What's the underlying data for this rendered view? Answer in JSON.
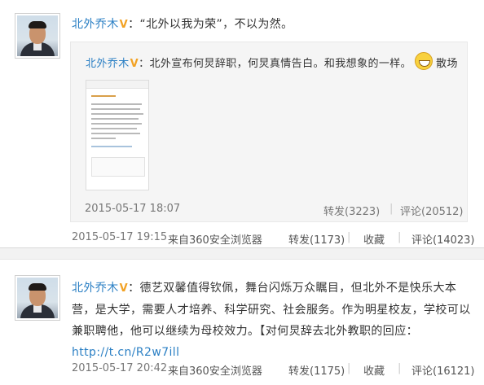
{
  "post1": {
    "user": "北外乔木",
    "text": "：“北外以我为荣”，不以为然。",
    "repost": {
      "user": "北外乔木",
      "text_before": "：北外宣布何炅辞职，何炅真情告白。和我想象的一样。",
      "emoji": "smile-emoji",
      "text_after": "散场",
      "time": "2015-05-17 18:07",
      "forward": "转发(3223)",
      "comment": "评论(20512)"
    },
    "time": "2015-05-17 19:15",
    "source": "来自360安全浏览器",
    "forward": "转发(1173)",
    "favorite": "收藏",
    "comment": "评论(14023)"
  },
  "post2": {
    "user": "北外乔木",
    "text": "：德艺双馨值得钦佩，舞台闪烁万众瞩目，但北外不是快乐大本营，是大学，需要人才培养、科学研究、社会服务。作为明星校友，学校可以兼职聘他，他可以继续为母校效力。【对何炅辞去北外教职的回应：",
    "link": "http://t.cn/R2w7ill",
    "time": "2015-05-17 20:42",
    "source": "来自360安全浏览器",
    "forward": "转发(1175)",
    "favorite": "收藏",
    "comment": "评论(16121)"
  },
  "colors": {
    "link": "#2a7fc4",
    "verified": "#f2a224",
    "repost_bg": "#f5f5f5"
  }
}
